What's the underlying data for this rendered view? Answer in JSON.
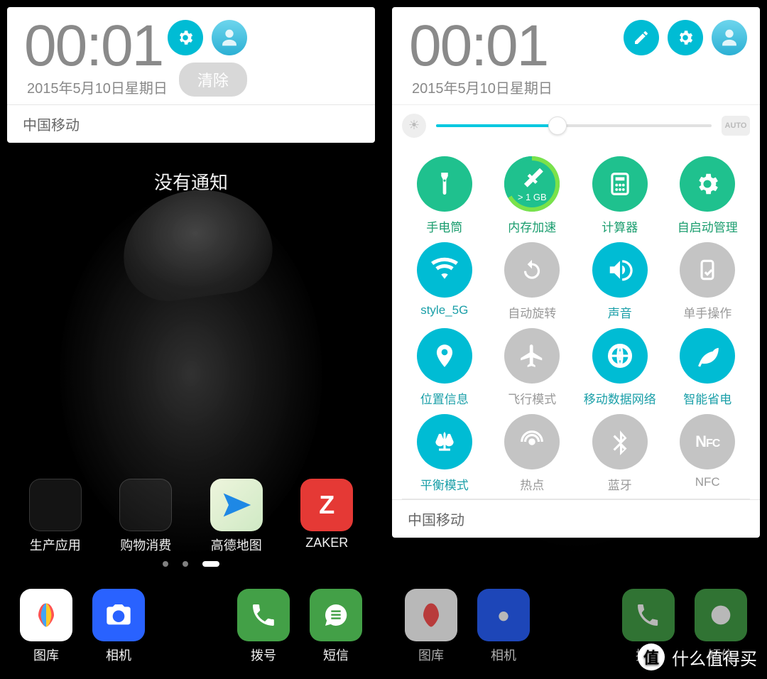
{
  "common": {
    "time": "00:01",
    "date": "2015年5月10日星期日",
    "carrier": "中国移动"
  },
  "left": {
    "clear_label": "清除",
    "no_notification": "没有通知",
    "home_apps": [
      {
        "label": "生产应用"
      },
      {
        "label": "购物消费"
      },
      {
        "label": "高德地图"
      },
      {
        "label": "ZAKER"
      }
    ],
    "dock_apps": [
      {
        "label": "图库"
      },
      {
        "label": "相机"
      },
      {
        "label": ""
      },
      {
        "label": "拨号"
      },
      {
        "label": "短信"
      }
    ]
  },
  "right": {
    "brightness_percent": 44,
    "auto_label": "AUTO",
    "memory_label": "> 1 GB",
    "tiles": [
      {
        "label": "手电筒",
        "state": "green",
        "icon": "flashlight"
      },
      {
        "label": "内存加速",
        "state": "green",
        "icon": "memory"
      },
      {
        "label": "计算器",
        "state": "green",
        "icon": "calculator"
      },
      {
        "label": "自启动管理",
        "state": "green",
        "icon": "gear"
      },
      {
        "label": "style_5G",
        "state": "on",
        "icon": "wifi"
      },
      {
        "label": "自动旋转",
        "state": "off",
        "icon": "rotate"
      },
      {
        "label": "声音",
        "state": "on",
        "icon": "sound"
      },
      {
        "label": "单手操作",
        "state": "off",
        "icon": "onehand"
      },
      {
        "label": "位置信息",
        "state": "on",
        "icon": "location"
      },
      {
        "label": "飞行模式",
        "state": "off",
        "icon": "airplane"
      },
      {
        "label": "移动数据网络",
        "state": "on",
        "icon": "data"
      },
      {
        "label": "智能省电",
        "state": "on",
        "icon": "leaf"
      },
      {
        "label": "平衡模式",
        "state": "on",
        "icon": "balance"
      },
      {
        "label": "热点",
        "state": "off",
        "icon": "hotspot"
      },
      {
        "label": "蓝牙",
        "state": "off",
        "icon": "bluetooth"
      },
      {
        "label": "NFC",
        "state": "off",
        "icon": "nfc"
      }
    ],
    "dock_apps": [
      {
        "label": "图库"
      },
      {
        "label": "相机"
      },
      {
        "label": ""
      },
      {
        "label": "拨号"
      },
      {
        "label": "短信"
      }
    ]
  },
  "watermark": "什么值得买"
}
